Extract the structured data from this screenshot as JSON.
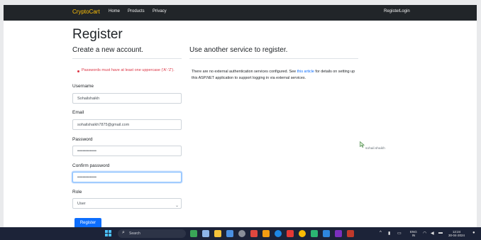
{
  "navbar": {
    "brand": "CryptoCart",
    "links": [
      "Home",
      "Products",
      "Privacy"
    ],
    "right_links": [
      "Register",
      "Login"
    ]
  },
  "page": {
    "title": "Register",
    "left_subtitle": "Create a new account.",
    "right_subtitle": "Use another service to register."
  },
  "validation": {
    "message": "Passwords must have at least one uppercase ('A'-'Z')."
  },
  "form": {
    "username_label": "Username",
    "username_value": "Sohailshaikh",
    "email_label": "Email",
    "email_value": "sohailshaikh7875@gmail.com",
    "password_label": "Password",
    "password_value": "••••••••••••••",
    "confirm_label": "Confirm password",
    "confirm_value": "••••••••••••••",
    "role_label": "Role",
    "role_value": "User",
    "submit_label": "Register"
  },
  "external": {
    "text_before": "There are no external authentication services configured. See ",
    "link_text": "this article",
    "text_after": " for details on setting up this ASP.NET application to support logging in via external services."
  },
  "watermark": "sohail.shaikh",
  "taskbar": {
    "search_placeholder": "Search",
    "lang_line1": "ENG",
    "lang_line2": "IN",
    "time": "12:24",
    "date": "30-04-2024"
  },
  "colors": {
    "navbar": "#212529",
    "brand": "#ffc107",
    "primary": "#0d6efd",
    "danger": "#dc3545",
    "taskbar": "#1c2338"
  }
}
